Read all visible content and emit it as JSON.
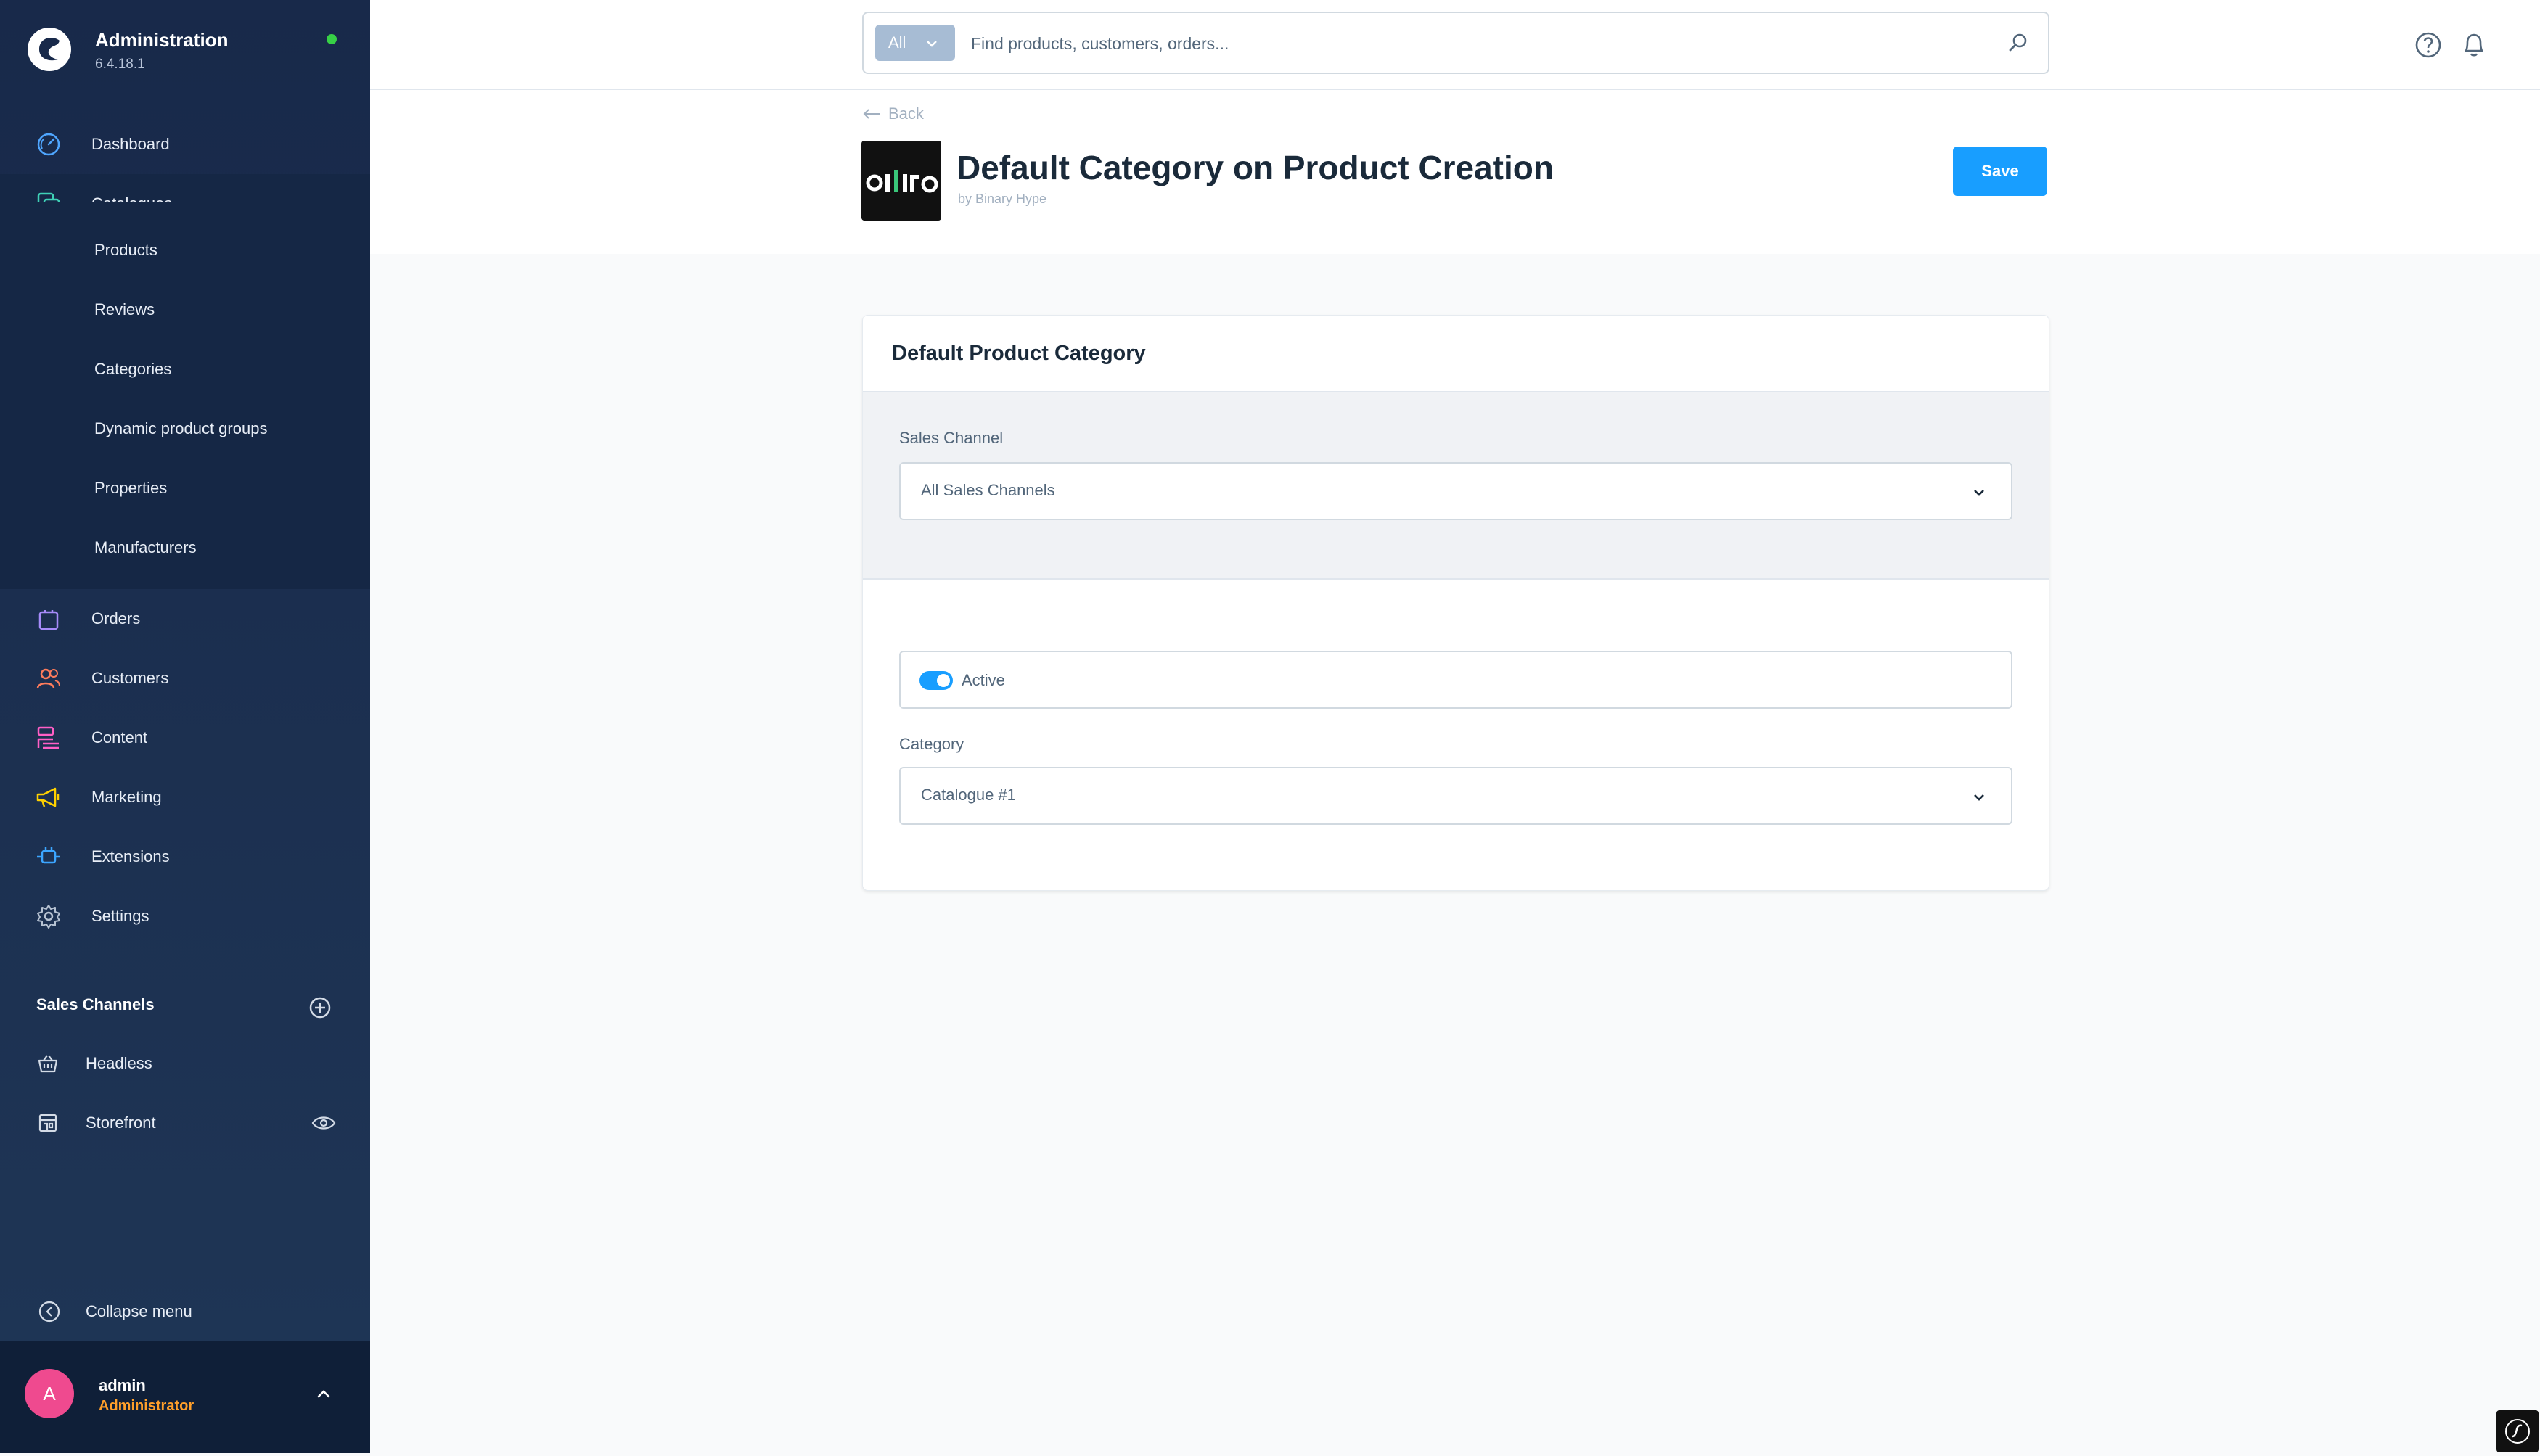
{
  "brand": {
    "title": "Administration",
    "version": "6.4.18.1",
    "status_color": "#37d046"
  },
  "nav": {
    "items": [
      {
        "label": "Dashboard",
        "icon": "dashboard-gauge-icon"
      },
      {
        "label": "Catalogues",
        "icon": "catalogues-icon"
      },
      {
        "label": "Orders",
        "icon": "shopping-bag-icon"
      },
      {
        "label": "Customers",
        "icon": "users-icon"
      },
      {
        "label": "Content",
        "icon": "content-icon"
      },
      {
        "label": "Marketing",
        "icon": "megaphone-icon"
      },
      {
        "label": "Extensions",
        "icon": "plug-icon"
      },
      {
        "label": "Settings",
        "icon": "gear-icon"
      }
    ],
    "catalogue_sub": [
      "Products",
      "Reviews",
      "Categories",
      "Dynamic product groups",
      "Properties",
      "Manufacturers"
    ]
  },
  "sales_channels": {
    "header": "Sales Channels",
    "items": [
      {
        "label": "Headless",
        "icon": "basket-icon"
      },
      {
        "label": "Storefront",
        "icon": "storefront-icon"
      }
    ]
  },
  "collapse_label": "Collapse menu",
  "user": {
    "initial": "A",
    "name": "admin",
    "role": "Administrator"
  },
  "search": {
    "type": "All",
    "placeholder": "Find products, customers, orders..."
  },
  "header": {
    "back": "Back",
    "title": "Default Category on Product Creation",
    "author": "by Binary Hype",
    "save": "Save"
  },
  "card": {
    "title": "Default Product Category",
    "sales_channel_label": "Sales Channel",
    "sales_channel_value": "All Sales Channels",
    "active_label": "Active",
    "active": true,
    "category_label": "Category",
    "category_value": "Catalogue #1"
  },
  "colors": {
    "accent": "#189eff",
    "sidebar": "#18294a",
    "role": "#ff9f2a",
    "avatar": "#ef4a8f"
  }
}
